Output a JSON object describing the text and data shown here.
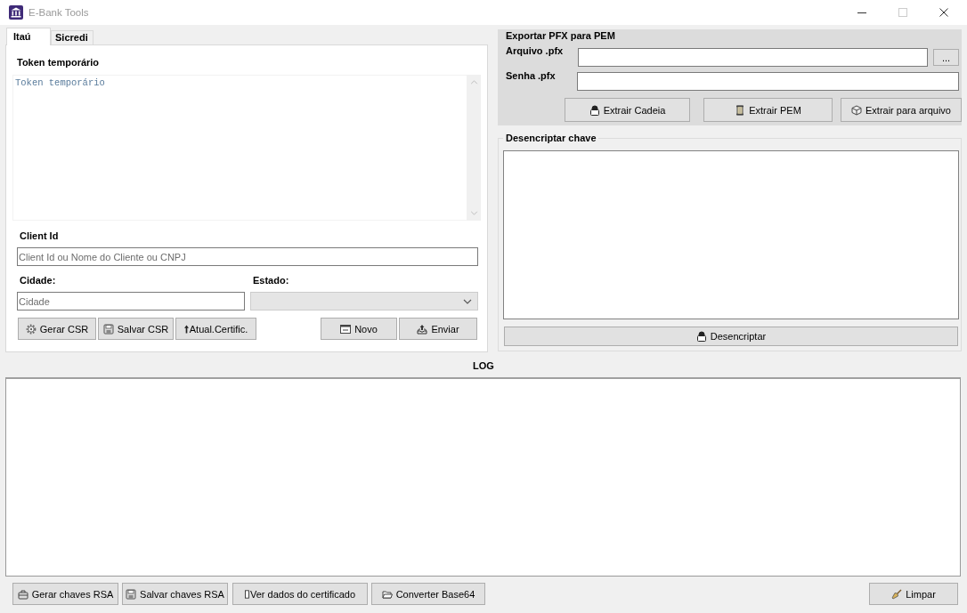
{
  "window": {
    "title": "E-Bank Tools",
    "maximize_disabled": true
  },
  "tabs": [
    {
      "label": "Itaú",
      "selected": true
    },
    {
      "label": "Sicredi",
      "selected": false
    }
  ],
  "token": {
    "label": "Token temporário",
    "placeholder": "Token temporário"
  },
  "client_id": {
    "label": "Client Id",
    "placeholder": "Client Id ou Nome do Cliente ou CNPJ"
  },
  "cidade": {
    "label": "Cidade:",
    "placeholder": "Cidade"
  },
  "estado": {
    "label": "Estado:",
    "disabled": true
  },
  "form_buttons_left": [
    "Gerar CSR",
    "Salvar CSR",
    "Atual.Certific."
  ],
  "form_buttons_right": [
    "Novo",
    "Enviar"
  ],
  "export_pfx": {
    "title": "Exportar PFX para PEM",
    "file_label": "Arquivo .pfx",
    "browse_button": "...",
    "password_label": "Senha .pfx",
    "buttons": [
      "Extrair Cadeia",
      "Extrair PEM",
      "Extrair para arquivo"
    ]
  },
  "decrypt": {
    "title": "Desencriptar chave",
    "button": "Desencriptar"
  },
  "log": {
    "title": "LOG"
  },
  "footer_buttons": [
    "Gerar chaves RSA",
    "Salvar chaves RSA",
    "Ver dados do certificado",
    "Converter Base64"
  ],
  "clear_button": "Limpar"
}
